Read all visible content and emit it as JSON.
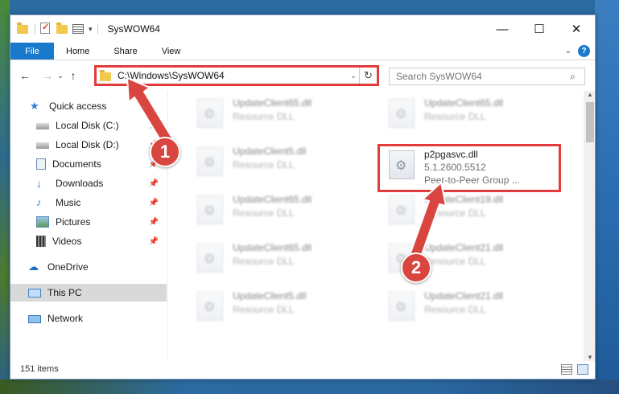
{
  "window": {
    "title": "SysWOW64",
    "controls": [
      "minimize",
      "maximize",
      "close"
    ]
  },
  "ribbon": {
    "tabs": [
      "File",
      "Home",
      "Share",
      "View"
    ],
    "help_label": "?"
  },
  "navigation": {
    "address": "C:\\Windows\\SysWOW64",
    "search_placeholder": "Search SysWOW64"
  },
  "sidebar": {
    "items": [
      {
        "label": "Quick access",
        "icon": "star-icon",
        "pinned": false
      },
      {
        "label": "Local Disk (C:)",
        "icon": "drive-icon",
        "pinned": true
      },
      {
        "label": "Local Disk (D:)",
        "icon": "drive-icon",
        "pinned": true
      },
      {
        "label": "Documents",
        "icon": "documents-icon",
        "pinned": true
      },
      {
        "label": "Downloads",
        "icon": "download-icon",
        "pinned": true
      },
      {
        "label": "Music",
        "icon": "music-icon",
        "pinned": true
      },
      {
        "label": "Pictures",
        "icon": "pictures-icon",
        "pinned": true
      },
      {
        "label": "Videos",
        "icon": "videos-icon",
        "pinned": true
      },
      {
        "label": "OneDrive",
        "icon": "cloud-icon",
        "pinned": false
      },
      {
        "label": "This PC",
        "icon": "computer-icon",
        "pinned": false,
        "selected": true
      },
      {
        "label": "Network",
        "icon": "network-icon",
        "pinned": false
      }
    ]
  },
  "files": [
    {
      "name": "UpdateClient65.dll",
      "type": "Resource DLL",
      "blurred": true
    },
    {
      "name": "UpdateClient65.dll",
      "type": "Resource DLL",
      "blurred": true
    },
    {
      "name": "UpdateClient5.dll",
      "type": "Resource DLL",
      "blurred": true
    },
    {
      "name": "p2pgasvc.dll",
      "version": "5.1.2600.5512",
      "type": "Peer-to-Peer Group ...",
      "blurred": false,
      "highlighted": true
    },
    {
      "name": "UpdateClient65.dll",
      "type": "Resource DLL",
      "blurred": true
    },
    {
      "name": "UpdateClient19.dll",
      "type": "Resource DLL",
      "blurred": true
    },
    {
      "name": "UpdateClient65.dll",
      "type": "Resource DLL",
      "blurred": true
    },
    {
      "name": "UpdateClient21.dll",
      "type": "Resource DLL",
      "blurred": true
    },
    {
      "name": "UpdateClient5.dll",
      "type": "Resource DLL",
      "blurred": true
    },
    {
      "name": "UpdateClient21.dll",
      "type": "Resource DLL",
      "blurred": true
    }
  ],
  "status": {
    "item_count": "151 items"
  },
  "annotations": {
    "callout_1": "1",
    "callout_2": "2",
    "highlight_color": "#e23b3b",
    "callout_color": "#d9463f"
  },
  "colors": {
    "accent": "#1979ca"
  }
}
